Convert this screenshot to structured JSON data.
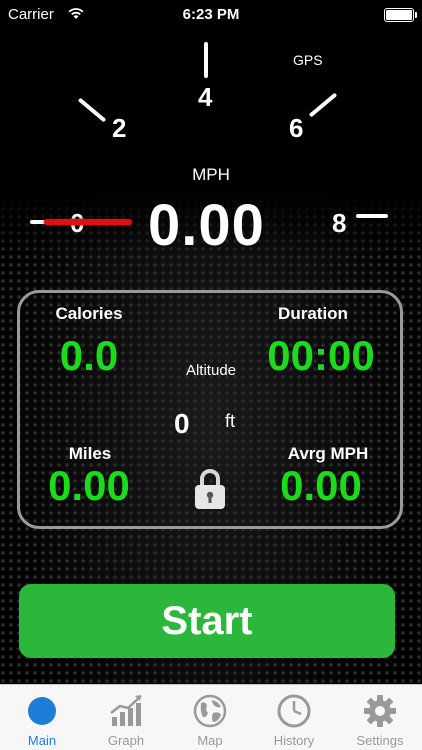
{
  "status_bar": {
    "carrier": "Carrier",
    "time": "6:23 PM"
  },
  "gauge": {
    "gps_label": "GPS",
    "unit_label": "MPH",
    "dial_numbers": [
      "0",
      "2",
      "4",
      "6",
      "8"
    ],
    "speed": "0.00"
  },
  "stats": {
    "calories": {
      "label": "Calories",
      "value": "0.0"
    },
    "duration": {
      "label": "Duration",
      "value": "00:00"
    },
    "altitude": {
      "label": "Altitude",
      "value": "0",
      "unit": "ft"
    },
    "miles": {
      "label": "Miles",
      "value": "0.00"
    },
    "avg_mph": {
      "label": "Avrg MPH",
      "value": "0.00"
    },
    "lock_icon": "lock-icon"
  },
  "start_button": {
    "label": "Start"
  },
  "tabs": [
    {
      "label": "Main",
      "icon": "circle-icon",
      "active": true
    },
    {
      "label": "Graph",
      "icon": "graph-icon",
      "active": false
    },
    {
      "label": "Map",
      "icon": "globe-icon",
      "active": false
    },
    {
      "label": "History",
      "icon": "clock-icon",
      "active": false
    },
    {
      "label": "Settings",
      "icon": "gear-icon",
      "active": false
    }
  ],
  "colors": {
    "accent_green": "#1bdc1b",
    "start_green": "#2bb63c",
    "needle_red": "#d11",
    "tab_active": "#1c7ed6"
  }
}
